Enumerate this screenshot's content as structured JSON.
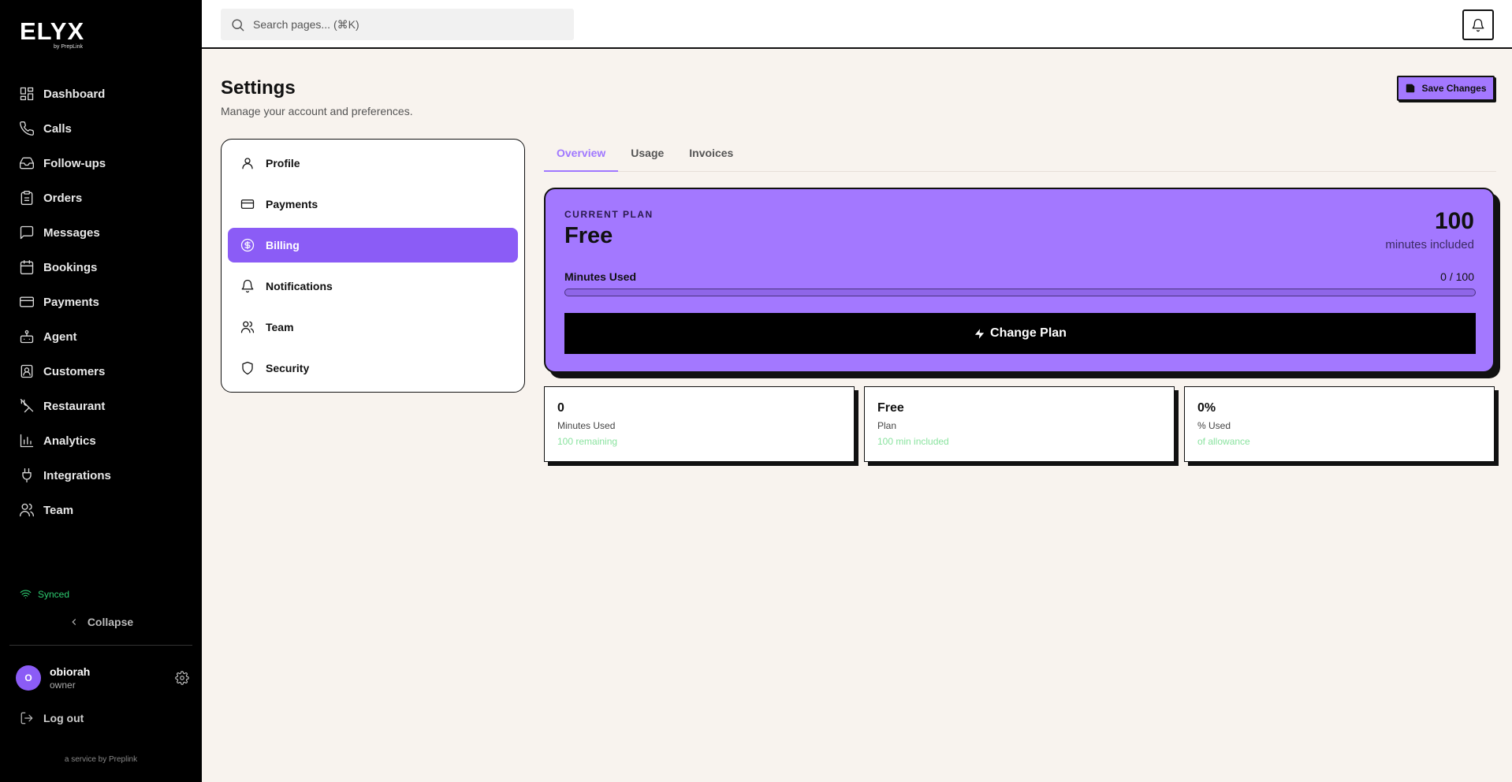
{
  "brand": {
    "name": "ELYX",
    "sub": "by PrepLink"
  },
  "sidebar": {
    "items": [
      {
        "label": "Dashboard",
        "icon": "dashboard-icon"
      },
      {
        "label": "Calls",
        "icon": "phone-icon"
      },
      {
        "label": "Follow-ups",
        "icon": "inbox-icon"
      },
      {
        "label": "Orders",
        "icon": "clipboard-icon"
      },
      {
        "label": "Messages",
        "icon": "message-icon"
      },
      {
        "label": "Bookings",
        "icon": "calendar-icon"
      },
      {
        "label": "Payments",
        "icon": "credit-card-icon"
      },
      {
        "label": "Agent",
        "icon": "bot-icon"
      },
      {
        "label": "Customers",
        "icon": "contact-icon"
      },
      {
        "label": "Restaurant",
        "icon": "utensils-icon"
      },
      {
        "label": "Analytics",
        "icon": "bar-chart-icon"
      },
      {
        "label": "Integrations",
        "icon": "plug-icon"
      },
      {
        "label": "Team",
        "icon": "users-icon"
      }
    ],
    "synced": "Synced",
    "collapse": "Collapse",
    "user": {
      "initial": "O",
      "name": "obiorah",
      "role": "owner"
    },
    "logout": "Log out",
    "service": "a service by Preplink"
  },
  "topbar": {
    "search_placeholder": "Search pages... (⌘K)"
  },
  "header": {
    "title": "Settings",
    "subtitle": "Manage your account and preferences.",
    "save_label": "Save Changes"
  },
  "settings_nav": {
    "items": [
      {
        "label": "Profile",
        "active": false
      },
      {
        "label": "Payments",
        "active": false
      },
      {
        "label": "Billing",
        "active": true
      },
      {
        "label": "Notifications",
        "active": false
      },
      {
        "label": "Team",
        "active": false
      },
      {
        "label": "Security",
        "active": false
      }
    ]
  },
  "tabs": [
    {
      "label": "Overview",
      "active": true
    },
    {
      "label": "Usage",
      "active": false
    },
    {
      "label": "Invoices",
      "active": false
    }
  ],
  "plan": {
    "label": "CURRENT PLAN",
    "name": "Free",
    "minutes": "100",
    "minutes_label": "minutes included",
    "usage_label": "Minutes Used",
    "usage_value": "0 / 100",
    "usage_fraction": 0,
    "change_label": "Change Plan"
  },
  "stats": [
    {
      "value": "0",
      "label": "Minutes Used",
      "note": "100 remaining"
    },
    {
      "value": "Free",
      "label": "Plan",
      "note": "100 min included"
    },
    {
      "value": "0%",
      "label": "% Used",
      "note": "of allowance"
    }
  ],
  "colors": {
    "accent": "#8b5cf6",
    "plan_bg": "#a378ff",
    "success": "#2ecc71",
    "sidebar_bg": "#000000",
    "page_bg": "#f8f3ee"
  }
}
